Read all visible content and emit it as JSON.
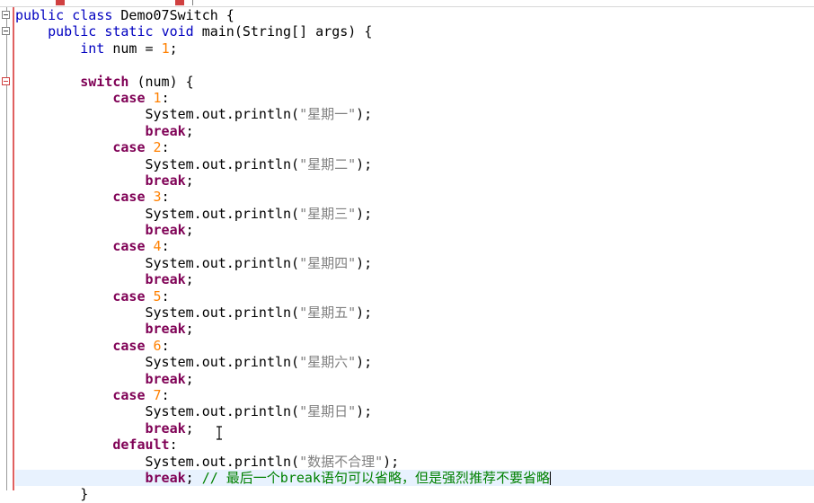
{
  "editor": {
    "lines": [
      {
        "indent": "",
        "tokens": [
          [
            "kw2",
            "public"
          ],
          [
            "t",
            " "
          ],
          [
            "kw2",
            "class"
          ],
          [
            "t",
            " Demo07Switch {"
          ]
        ]
      },
      {
        "indent": "    ",
        "tokens": [
          [
            "kw2",
            "public"
          ],
          [
            "t",
            " "
          ],
          [
            "kw2",
            "static"
          ],
          [
            "t",
            " "
          ],
          [
            "kw2",
            "void"
          ],
          [
            "t",
            " main(String[] args) {"
          ]
        ]
      },
      {
        "indent": "        ",
        "tokens": [
          [
            "kw2",
            "int"
          ],
          [
            "t",
            " num = "
          ],
          [
            "num",
            "1"
          ],
          [
            "t",
            ";"
          ]
        ]
      },
      {
        "indent": "",
        "tokens": []
      },
      {
        "indent": "        ",
        "tokens": [
          [
            "kw",
            "switch"
          ],
          [
            "t",
            " (num) {"
          ]
        ]
      },
      {
        "indent": "            ",
        "tokens": [
          [
            "kw",
            "case"
          ],
          [
            "t",
            " "
          ],
          [
            "num",
            "1"
          ],
          [
            "t",
            ":"
          ]
        ]
      },
      {
        "indent": "                ",
        "tokens": [
          [
            "t",
            "System.out.println("
          ],
          [
            "str",
            "\"星期一\""
          ],
          [
            "t",
            ");"
          ]
        ]
      },
      {
        "indent": "                ",
        "tokens": [
          [
            "kw",
            "break"
          ],
          [
            "t",
            ";"
          ]
        ]
      },
      {
        "indent": "            ",
        "tokens": [
          [
            "kw",
            "case"
          ],
          [
            "t",
            " "
          ],
          [
            "num",
            "2"
          ],
          [
            "t",
            ":"
          ]
        ]
      },
      {
        "indent": "                ",
        "tokens": [
          [
            "t",
            "System.out.println("
          ],
          [
            "str",
            "\"星期二\""
          ],
          [
            "t",
            ");"
          ]
        ]
      },
      {
        "indent": "                ",
        "tokens": [
          [
            "kw",
            "break"
          ],
          [
            "t",
            ";"
          ]
        ]
      },
      {
        "indent": "            ",
        "tokens": [
          [
            "kw",
            "case"
          ],
          [
            "t",
            " "
          ],
          [
            "num",
            "3"
          ],
          [
            "t",
            ":"
          ]
        ]
      },
      {
        "indent": "                ",
        "tokens": [
          [
            "t",
            "System.out.println("
          ],
          [
            "str",
            "\"星期三\""
          ],
          [
            "t",
            ");"
          ]
        ]
      },
      {
        "indent": "                ",
        "tokens": [
          [
            "kw",
            "break"
          ],
          [
            "t",
            ";"
          ]
        ]
      },
      {
        "indent": "            ",
        "tokens": [
          [
            "kw",
            "case"
          ],
          [
            "t",
            " "
          ],
          [
            "num",
            "4"
          ],
          [
            "t",
            ":"
          ]
        ]
      },
      {
        "indent": "                ",
        "tokens": [
          [
            "t",
            "System.out.println("
          ],
          [
            "str",
            "\"星期四\""
          ],
          [
            "t",
            ");"
          ]
        ]
      },
      {
        "indent": "                ",
        "tokens": [
          [
            "kw",
            "break"
          ],
          [
            "t",
            ";"
          ]
        ]
      },
      {
        "indent": "            ",
        "tokens": [
          [
            "kw",
            "case"
          ],
          [
            "t",
            " "
          ],
          [
            "num",
            "5"
          ],
          [
            "t",
            ":"
          ]
        ]
      },
      {
        "indent": "                ",
        "tokens": [
          [
            "t",
            "System.out.println("
          ],
          [
            "str",
            "\"星期五\""
          ],
          [
            "t",
            ");"
          ]
        ]
      },
      {
        "indent": "                ",
        "tokens": [
          [
            "kw",
            "break"
          ],
          [
            "t",
            ";"
          ]
        ]
      },
      {
        "indent": "            ",
        "tokens": [
          [
            "kw",
            "case"
          ],
          [
            "t",
            " "
          ],
          [
            "num",
            "6"
          ],
          [
            "t",
            ":"
          ]
        ]
      },
      {
        "indent": "                ",
        "tokens": [
          [
            "t",
            "System.out.println("
          ],
          [
            "str",
            "\"星期六\""
          ],
          [
            "t",
            ");"
          ]
        ]
      },
      {
        "indent": "                ",
        "tokens": [
          [
            "kw",
            "break"
          ],
          [
            "t",
            ";"
          ]
        ]
      },
      {
        "indent": "            ",
        "tokens": [
          [
            "kw",
            "case"
          ],
          [
            "t",
            " "
          ],
          [
            "num",
            "7"
          ],
          [
            "t",
            ":"
          ]
        ]
      },
      {
        "indent": "                ",
        "tokens": [
          [
            "t",
            "System.out.println("
          ],
          [
            "str",
            "\"星期日\""
          ],
          [
            "t",
            ");"
          ]
        ]
      },
      {
        "indent": "                ",
        "tokens": [
          [
            "kw",
            "break"
          ],
          [
            "t",
            ";"
          ]
        ]
      },
      {
        "indent": "            ",
        "tokens": [
          [
            "kw",
            "default"
          ],
          [
            "t",
            ":"
          ]
        ]
      },
      {
        "indent": "                ",
        "tokens": [
          [
            "t",
            "System.out.println("
          ],
          [
            "str",
            "\"数据不合理\""
          ],
          [
            "t",
            ");"
          ]
        ]
      },
      {
        "indent": "                ",
        "tokens": [
          [
            "kw",
            "break"
          ],
          [
            "t",
            "; "
          ],
          [
            "cmt",
            "// 最后一个break语句可以省略，但是强烈推荐不要省略"
          ]
        ],
        "current": true
      },
      {
        "indent": "        ",
        "tokens": [
          [
            "t",
            "}"
          ]
        ]
      }
    ]
  },
  "colors": {
    "keyword_bold": "#7f0055",
    "keyword": "#0000c0",
    "number": "#ff8000",
    "string": "#808080",
    "comment": "#008000",
    "current_line": "#e8f2fe",
    "change_bar": "#e06060"
  },
  "icons": {
    "fold_markers": [
      "fold-collapse-icon",
      "fold-collapse-icon",
      "fold-collapse-icon"
    ],
    "cursor": "text-cursor-icon"
  }
}
